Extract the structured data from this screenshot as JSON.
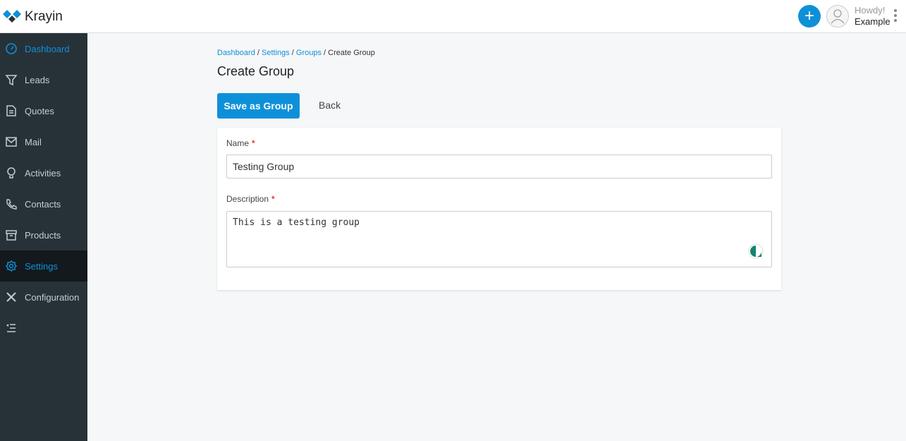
{
  "app": {
    "name": "Krayin"
  },
  "header": {
    "greeting": "Howdy!",
    "user": "Example"
  },
  "sidebar": {
    "items": [
      {
        "label": "Dashboard"
      },
      {
        "label": "Leads"
      },
      {
        "label": "Quotes"
      },
      {
        "label": "Mail"
      },
      {
        "label": "Activities"
      },
      {
        "label": "Contacts"
      },
      {
        "label": "Products"
      },
      {
        "label": "Settings"
      },
      {
        "label": "Configuration"
      }
    ]
  },
  "breadcrumb": [
    "Dashboard",
    "Settings",
    "Groups",
    "Create Group"
  ],
  "page": {
    "title": "Create Group",
    "save_label": "Save as Group",
    "back_label": "Back"
  },
  "form": {
    "name_label": "Name",
    "name_value": "Testing Group",
    "desc_label": "Description",
    "desc_value": "This is a testing group",
    "required_mark": "*"
  },
  "colors": {
    "accent": "#0e90d9",
    "sidebar": "#273238"
  }
}
